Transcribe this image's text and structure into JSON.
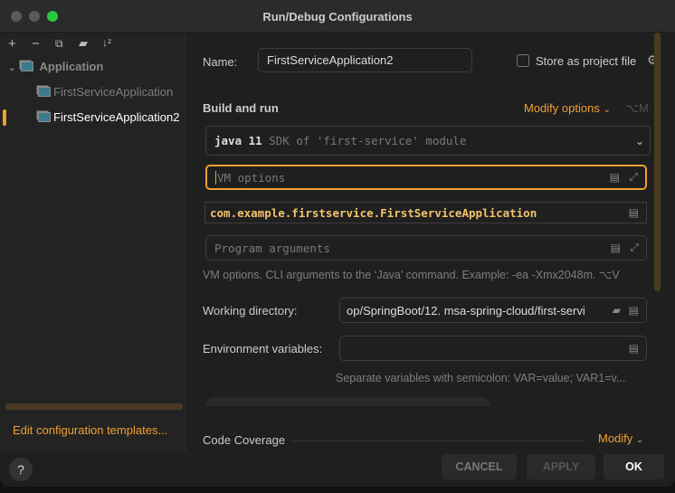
{
  "window": {
    "title": "Run/Debug Configurations"
  },
  "toolbar": {
    "add": "+",
    "remove": "−",
    "copy": "copy-icon",
    "folder": "new-folder-icon",
    "sort": "sort-az-icon"
  },
  "tree": {
    "group": "Application",
    "items": [
      {
        "label": "FirstServiceApplication",
        "selected": false
      },
      {
        "label": "FirstServiceApplication2",
        "selected": true
      }
    ]
  },
  "left_footer": {
    "edit_templates": "Edit configuration templates..."
  },
  "form": {
    "name_label": "Name:",
    "name_value": "FirstServiceApplication2",
    "store_label": "Store as project file",
    "store_checked": false,
    "build_run_title": "Build and run",
    "modify_options": "Modify options",
    "modify_shortcut": "⌥M",
    "sdk_bold": "java 11",
    "sdk_rest": " SDK of 'first-service' module",
    "vm_placeholder": "VM options",
    "main_class": "com.example.firstservice.FirstServiceApplication",
    "program_args_placeholder": "Program arguments",
    "vm_hint": "VM options. CLI arguments to the ‘Java’ command. Example: -ea -Xmx2048m. ⌥V",
    "workdir_label": "Working directory:",
    "workdir_value": "op/SpringBoot/12. msa-spring-cloud/first-servi",
    "env_label": "Environment variables:",
    "env_value": "",
    "env_hint": "Separate variables with semicolon: VAR=value; VAR1=v...",
    "coverage_title": "Code Coverage",
    "coverage_modify": "Modify"
  },
  "buttons": {
    "help": "?",
    "cancel": "CANCEL",
    "apply": "APPLY",
    "ok": "OK"
  },
  "colors": {
    "accent": "#f0a030",
    "background": "#1f1f1f"
  }
}
